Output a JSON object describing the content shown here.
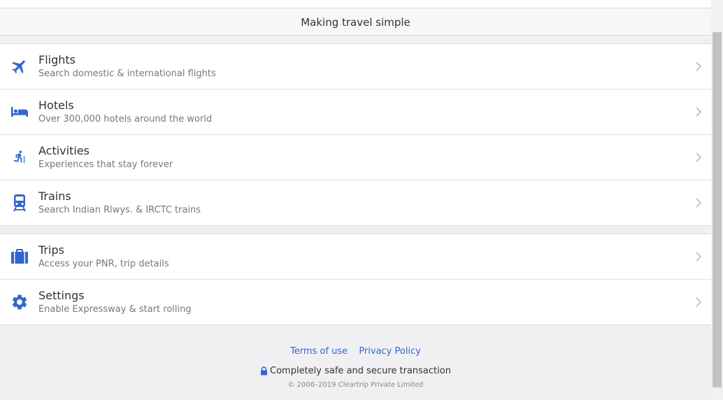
{
  "header": {
    "tagline": "Making travel simple"
  },
  "menu_primary": [
    {
      "key": "flights",
      "icon": "airplane-icon",
      "title": "Flights",
      "subtitle": "Search domestic & international flights"
    },
    {
      "key": "hotels",
      "icon": "bed-icon",
      "title": "Hotels",
      "subtitle": "Over 300,000 hotels around the world"
    },
    {
      "key": "activities",
      "icon": "hiker-icon",
      "title": "Activities",
      "subtitle": "Experiences that stay forever"
    },
    {
      "key": "trains",
      "icon": "train-icon",
      "title": "Trains",
      "subtitle": "Search Indian Rlwys. & IRCTC trains"
    }
  ],
  "menu_secondary": [
    {
      "key": "trips",
      "icon": "briefcase-icon",
      "title": "Trips",
      "subtitle": "Access your PNR, trip details"
    },
    {
      "key": "settings",
      "icon": "gear-icon",
      "title": "Settings",
      "subtitle": "Enable Expressway & start rolling"
    }
  ],
  "footer": {
    "terms_label": "Terms of use",
    "privacy_label": "Privacy Policy",
    "secure_text": "Completely safe and secure transaction",
    "copyright": "© 2006–2019 Cleartrip Private Limited"
  },
  "colors": {
    "accent": "#3366cc",
    "icon_blue": "#3366cc",
    "chevron": "#bbbbbb"
  }
}
